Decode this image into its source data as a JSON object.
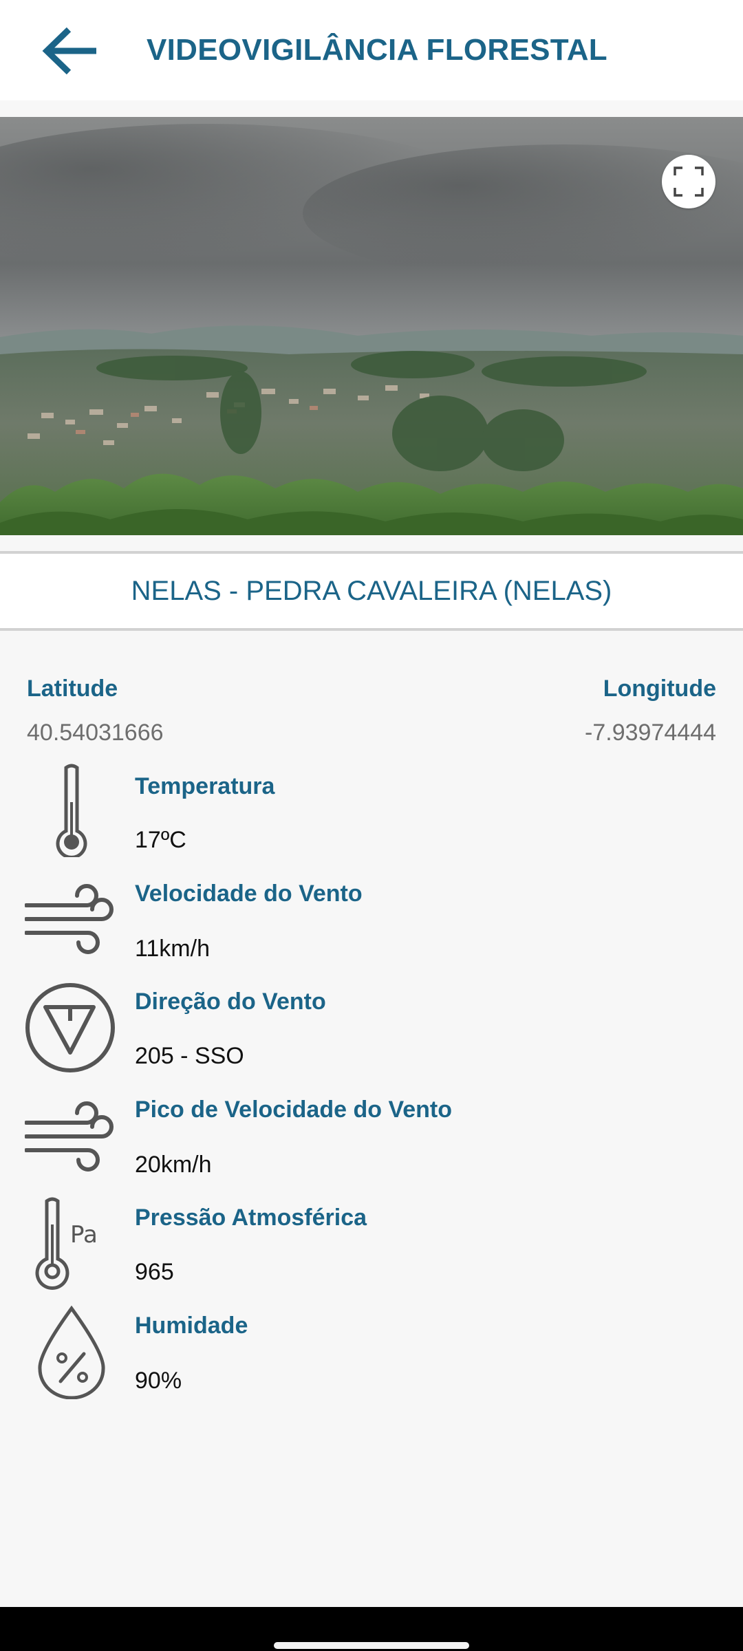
{
  "header": {
    "title": "VIDEOVIGILÂNCIA FLORESTAL",
    "back_icon": "arrow-left-icon"
  },
  "camera": {
    "fullscreen_icon": "fullscreen-icon"
  },
  "station": {
    "name": "NELAS - PEDRA CAVALEIRA (NELAS)"
  },
  "coordinates": {
    "latitude_label": "Latitude",
    "latitude_value": "40.54031666",
    "longitude_label": "Longitude",
    "longitude_value": "-7.93974444"
  },
  "metrics": [
    {
      "icon": "thermometer-icon",
      "label": "Temperatura",
      "value": "17ºC"
    },
    {
      "icon": "wind-icon",
      "label": "Velocidade do Vento",
      "value": "11km/h"
    },
    {
      "icon": "wind-direction-icon",
      "label": "Direção do Vento",
      "value": "205 - SSO"
    },
    {
      "icon": "wind-gust-icon",
      "label": "Pico de Velocidade do Vento",
      "value": "20km/h"
    },
    {
      "icon": "pressure-icon",
      "label": "Pressão Atmosférica",
      "value": "965"
    },
    {
      "icon": "humidity-icon",
      "label": "Humidade",
      "value": "90%"
    }
  ],
  "colors": {
    "accent": "#1b6488",
    "icon_gray": "#555555",
    "background": "#f7f7f7"
  }
}
